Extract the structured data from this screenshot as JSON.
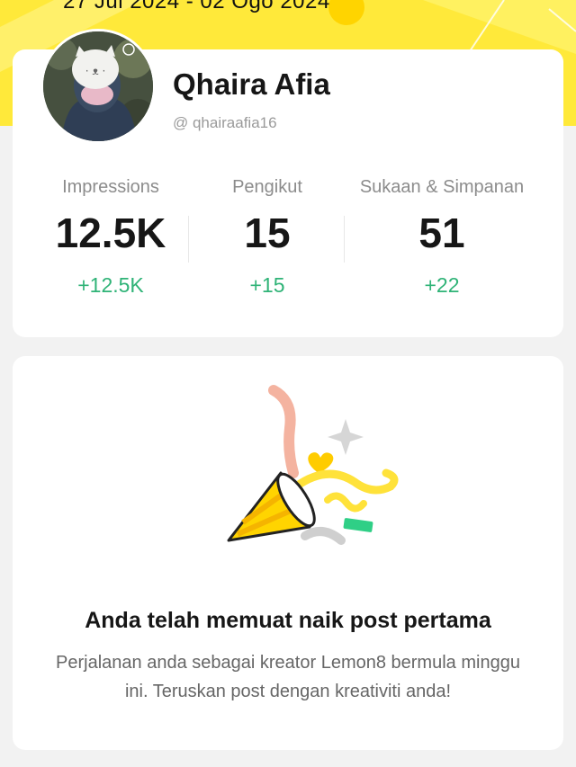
{
  "header": {
    "date_range": "27 Jul 2024 - 02 Ogo 2024"
  },
  "profile": {
    "name": "Qhaira Afia",
    "handle": "@ qhairaafia16"
  },
  "stats": [
    {
      "label": "Impressions",
      "value": "12.5K",
      "delta": "+12.5K"
    },
    {
      "label": "Pengikut",
      "value": "15",
      "delta": "+15"
    },
    {
      "label": "Sukaan & Simpanan",
      "value": "51",
      "delta": "+22"
    }
  ],
  "first_post": {
    "title": "Anda telah memuat naik post pertama",
    "description": "Perjalanan anda sebagai kreator Lemon8 bermula minggu ini. Teruskan post dengan kreativiti anda!"
  },
  "colors": {
    "banner": "#ffe93a",
    "delta": "#2fb377",
    "accent": "#ffd600"
  },
  "icons": [
    "party-popper-icon",
    "sparkle-icon",
    "heart-icon"
  ]
}
